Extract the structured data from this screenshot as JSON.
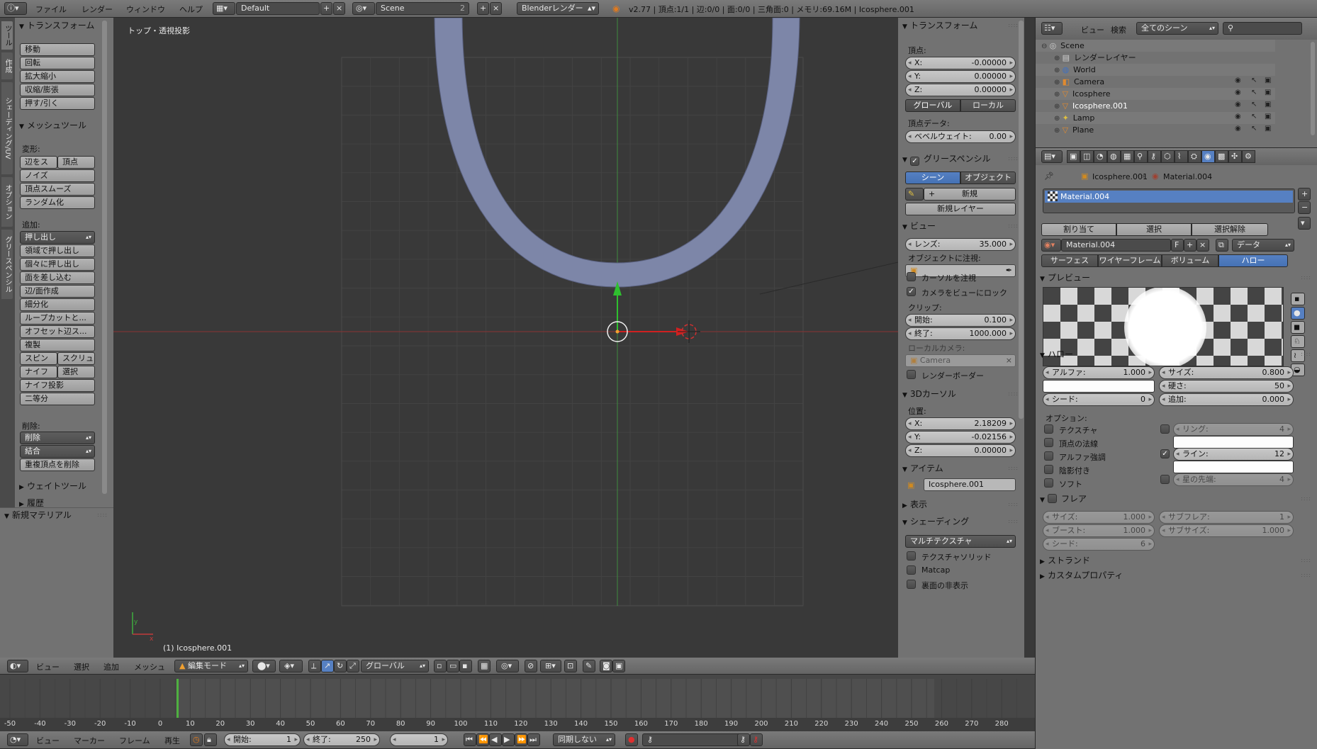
{
  "topbar": {
    "menus": [
      "ファイル",
      "レンダー",
      "ウィンドウ",
      "ヘルプ"
    ],
    "layout": "Default",
    "scene": "Scene",
    "scene_users": "2",
    "engine": "Blenderレンダー",
    "stats": "v2.77 | 頂点:1/1 | 辺:0/0 | 面:0/0 | 三角面:0 | メモリ:69.16M | Icosphere.001"
  },
  "tool_tabs": [
    "ツール",
    "作成",
    "シェーディング/UV",
    "オプション",
    "グリースペンシル"
  ],
  "tool_shelf": {
    "transform_header": "トランスフォーム",
    "transform_buttons": [
      "移動",
      "回転",
      "拡大縮小",
      "収縮/膨張",
      "押す/引く"
    ],
    "mesh_header": "メッシュツール",
    "deform_label": "変形:",
    "deform_row": [
      "辺をス",
      "頂点"
    ],
    "deform_buttons": [
      "ノイズ",
      "頂点スムーズ",
      "ランダム化"
    ],
    "add_label": "追加:",
    "extrude": "押し出し",
    "add_buttons": [
      "領域で押し出し",
      "個々に押し出し",
      "面を差し込む",
      "辺/面作成",
      "細分化",
      "ループカットと...",
      "オフセット辺ス...",
      "複製"
    ],
    "spin_row": [
      "スピン",
      "スクリュ"
    ],
    "knife_row": [
      "ナイフ",
      "選択"
    ],
    "add_buttons2": [
      "ナイフ投影",
      "二等分"
    ],
    "delete_label": "削除:",
    "delete": "削除",
    "merge": "結合",
    "remove_doubles": "重複頂点を削除",
    "weight_header": "ウェイトツール",
    "history_header": "履歴",
    "new_material": "新規マテリアル"
  },
  "viewport": {
    "view_label": "トップ・透視投影",
    "object_label": "(1) Icosphere.001",
    "axis_x": "x",
    "axis_y": "y"
  },
  "n_panel": {
    "transform": "トランスフォーム",
    "vertex": "頂点:",
    "vx": {
      "l": "X:",
      "v": "-0.00000"
    },
    "vy": {
      "l": "Y:",
      "v": "0.00000"
    },
    "vz": {
      "l": "Z:",
      "v": "0.00000"
    },
    "global": "グローバル",
    "local": "ローカル",
    "vertex_data": "頂点データ:",
    "bevel": {
      "l": "ベベルウェイト:",
      "v": "0.00"
    },
    "grease": "グリースペンシル",
    "gp_scene": "シーン",
    "gp_object": "オブジェクト",
    "gp_new": "新規",
    "gp_new_layer": "新規レイヤー",
    "view": "ビュー",
    "lens": {
      "l": "レンズ:",
      "v": "35.000"
    },
    "lock_object": "オブジェクトに注視:",
    "lock_cursor": "カーソルを注視",
    "lock_camera": "カメラをビューにロック",
    "clip": "クリップ:",
    "clip_start": {
      "l": "開始:",
      "v": "0.100"
    },
    "clip_end": {
      "l": "終了:",
      "v": "1000.000"
    },
    "local_camera": "ローカルカメラ:",
    "camera": "Camera",
    "render_border": "レンダーボーダー",
    "cursor": "3Dカーソル",
    "location": "位置:",
    "cx": {
      "l": "X:",
      "v": "2.18209"
    },
    "cy": {
      "l": "Y:",
      "v": "-0.02156"
    },
    "cz": {
      "l": "Z:",
      "v": "0.00000"
    },
    "item": "アイテム",
    "item_name": "Icosphere.001",
    "display": "表示",
    "shading": "シェーディング",
    "multitexture": "マルチテクスチャ",
    "textured_solid": "テクスチャソリッド",
    "matcap": "Matcap",
    "backface": "裏面の非表示"
  },
  "view3d_header": {
    "menus": [
      "ビュー",
      "選択",
      "追加",
      "メッシュ"
    ],
    "mode": "編集モード",
    "orientation": "グローバル"
  },
  "timeline": {
    "ticks": [
      "-50",
      "-40",
      "-30",
      "-20",
      "-10",
      "0",
      "10",
      "20",
      "30",
      "40",
      "50",
      "60",
      "70",
      "80",
      "90",
      "100",
      "110",
      "120",
      "130",
      "140",
      "150",
      "160",
      "170",
      "180",
      "190",
      "200",
      "210",
      "220",
      "230",
      "240",
      "250",
      "260",
      "270",
      "280"
    ],
    "menus": [
      "ビュー",
      "マーカー",
      "フレーム",
      "再生"
    ],
    "start": {
      "l": "開始:",
      "v": "1"
    },
    "end": {
      "l": "終了:",
      "v": "250"
    },
    "current": "1",
    "sync": "同期しない"
  },
  "outliner": {
    "menus": [
      "ビュー",
      "検索"
    ],
    "filter": "全てのシーン",
    "items": [
      {
        "name": "Scene",
        "depth": 0
      },
      {
        "name": "レンダーレイヤー",
        "depth": 1
      },
      {
        "name": "World",
        "depth": 1
      },
      {
        "name": "Camera",
        "depth": 1
      },
      {
        "name": "Icosphere",
        "depth": 1
      },
      {
        "name": "Icosphere.001",
        "depth": 1
      },
      {
        "name": "Lamp",
        "depth": 1
      },
      {
        "name": "Plane",
        "depth": 1
      }
    ]
  },
  "properties": {
    "breadcrumb": [
      "Icosphere.001",
      "Material.004"
    ],
    "slot": "Material.004",
    "assign": "割り当て",
    "select": "選択",
    "deselect": "選択解除",
    "material_name": "Material.004",
    "fake_user": "F",
    "link": "データ",
    "tabs": [
      "サーフェス",
      "ワイヤーフレーム",
      "ボリューム",
      "ハロー"
    ],
    "preview_header": "プレビュー",
    "halo_header": "ハロー",
    "alpha": {
      "l": "アルファ:",
      "v": "1.000"
    },
    "size": {
      "l": "サイズ:",
      "v": "0.800"
    },
    "hardness": {
      "l": "硬さ:",
      "v": "50"
    },
    "seed": {
      "l": "シード:",
      "v": "0"
    },
    "add": {
      "l": "追加:",
      "v": "0.000"
    },
    "options": "オプション:",
    "opt_left": [
      "テクスチャ",
      "頂点の法線",
      "アルファ強調",
      "陰影付き",
      "ソフト"
    ],
    "rings": {
      "l": "リング:",
      "v": "4"
    },
    "lines": {
      "l": "ライン:",
      "v": "12"
    },
    "star": {
      "l": "星の先端:",
      "v": "4"
    },
    "flare_header": "フレア",
    "f_size": {
      "l": "サイズ:",
      "v": "1.000"
    },
    "f_subflare": {
      "l": "サブフレア:",
      "v": "1"
    },
    "f_boost": {
      "l": "ブースト:",
      "v": "1.000"
    },
    "f_subsize": {
      "l": "サブサイズ:",
      "v": "1.000"
    },
    "f_seed": {
      "l": "シード:",
      "v": "6"
    },
    "strand_header": "ストランド",
    "custom_header": "カスタムプロパティ"
  },
  "colors": {
    "accent": "#5680c2",
    "mesh": "#7d86a8",
    "x_axis": "#c23b3b",
    "y_axis": "#3fae3f"
  }
}
